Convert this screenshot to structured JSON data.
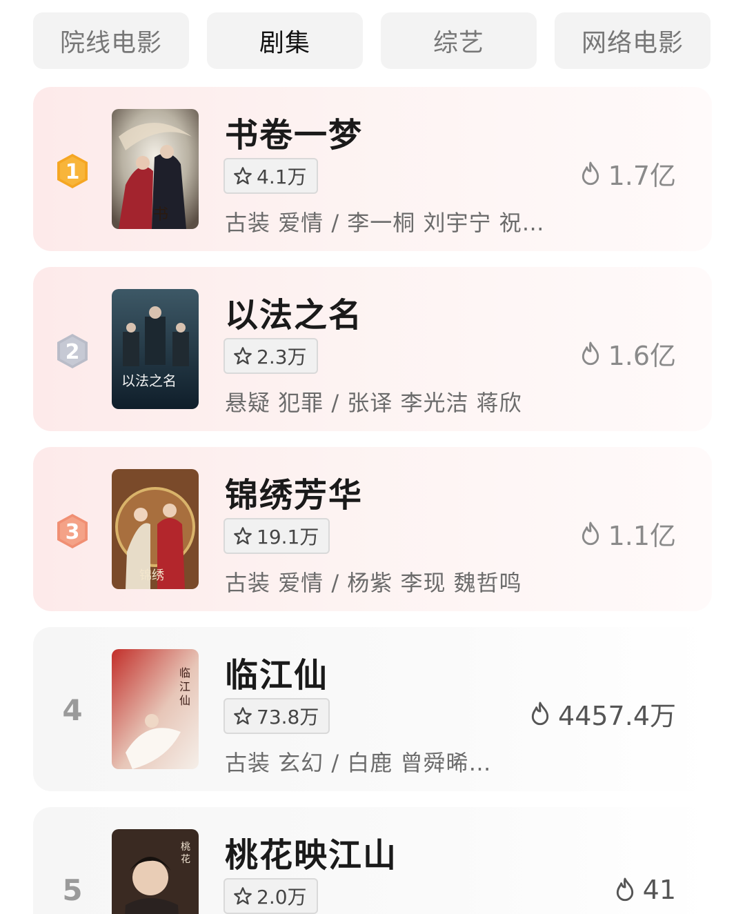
{
  "tabs": [
    {
      "label": "院线电影",
      "active": false
    },
    {
      "label": "剧集",
      "active": true
    },
    {
      "label": "综艺",
      "active": false
    },
    {
      "label": "网络电影",
      "active": false
    }
  ],
  "items": [
    {
      "rank": "1",
      "title": "书卷一梦",
      "score": "4.1万",
      "desc": "古装 爱情 / 李一桐 刘宇宁 祝…",
      "heat": "1.7亿",
      "badge_color": "#f5a623"
    },
    {
      "rank": "2",
      "title": "以法之名",
      "score": "2.3万",
      "desc": "悬疑 犯罪 / 张译 李光洁 蒋欣",
      "heat": "1.6亿",
      "badge_color": "#b9bcc8"
    },
    {
      "rank": "3",
      "title": "锦绣芳华",
      "score": "19.1万",
      "desc": "古装 爱情 / 杨紫 李现 魏哲鸣",
      "heat": "1.1亿",
      "badge_color": "#f08f73"
    },
    {
      "rank": "4",
      "title": "临江仙",
      "score": "73.8万",
      "desc": "古装 玄幻 / 白鹿 曾舜晞…",
      "heat": "4457.4万"
    },
    {
      "rank": "5",
      "title": "桃花映江山",
      "score": "2.0万",
      "desc": "",
      "heat": "41"
    }
  ],
  "icons": {
    "score": "star-outline-icon",
    "heat": "flame-icon"
  }
}
